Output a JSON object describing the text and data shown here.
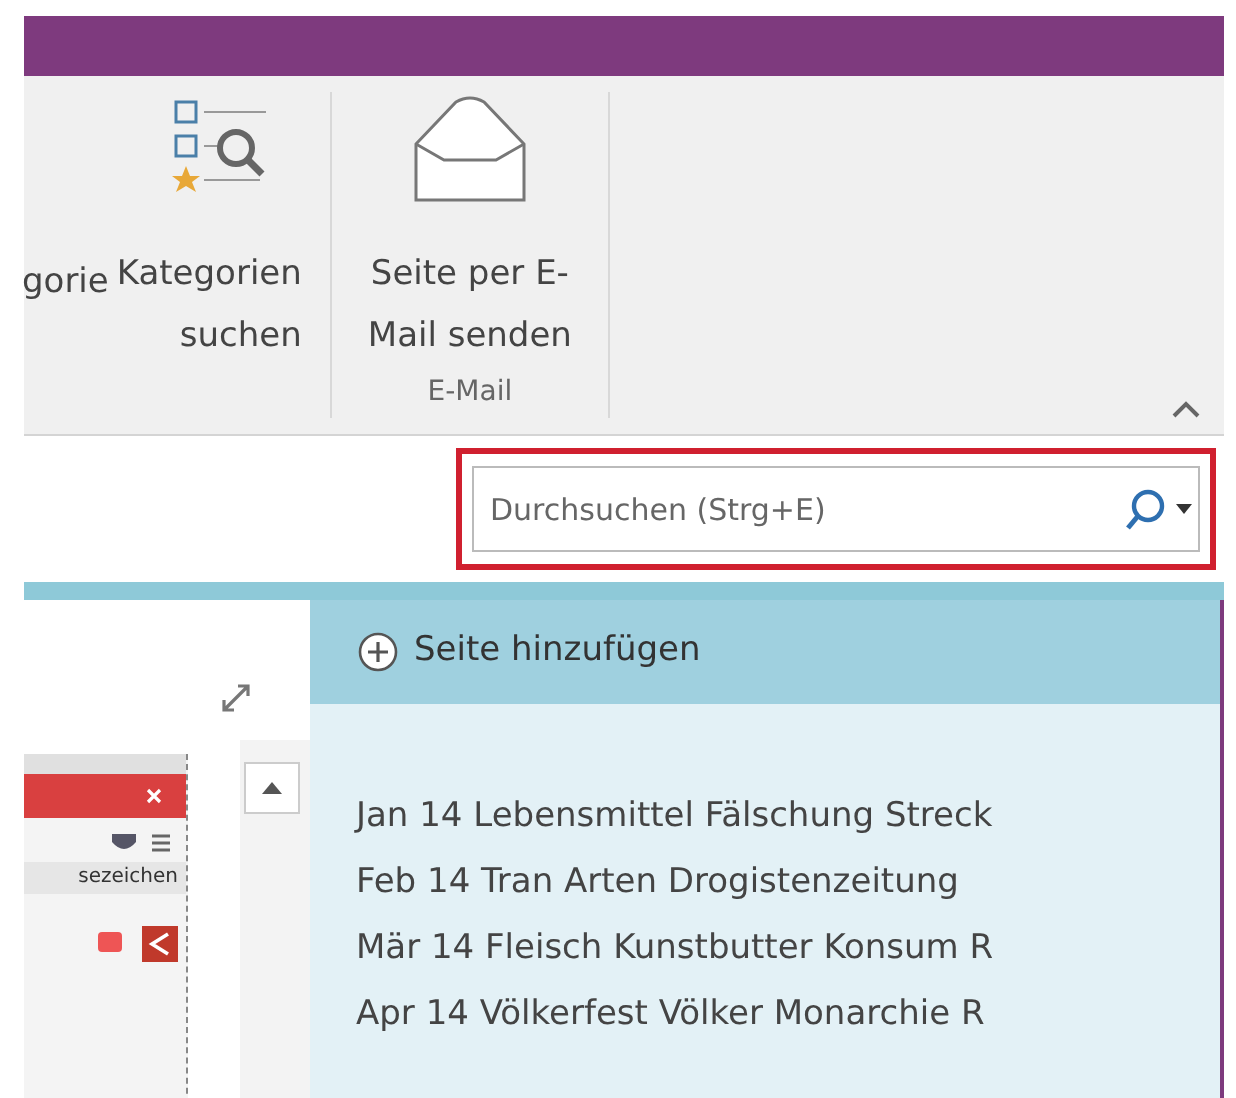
{
  "ribbon": {
    "cut_label": "gorie",
    "buttons": [
      {
        "label_lines": [
          "Kategorien",
          "suchen"
        ],
        "kind": "category-search"
      },
      {
        "label_lines": [
          "Seite per E-",
          "Mail senden"
        ],
        "kind": "mail"
      }
    ],
    "group_label": "E-Mail"
  },
  "search": {
    "placeholder": "Durchsuchen (Strg+E)"
  },
  "thumbnail": {
    "caption": "sezeichen"
  },
  "pages": {
    "add_label": "Seite hinzufügen",
    "items": [
      {
        "title": "Jan 14 Lebensmittel Fälschung Streck"
      },
      {
        "title": "Feb 14 Tran Arten Drogistenzeitung"
      },
      {
        "title": "Mär 14 Fleisch Kunstbutter Konsum R"
      },
      {
        "title": "Apr 14 Völkerfest Völker Monarchie R"
      }
    ]
  }
}
